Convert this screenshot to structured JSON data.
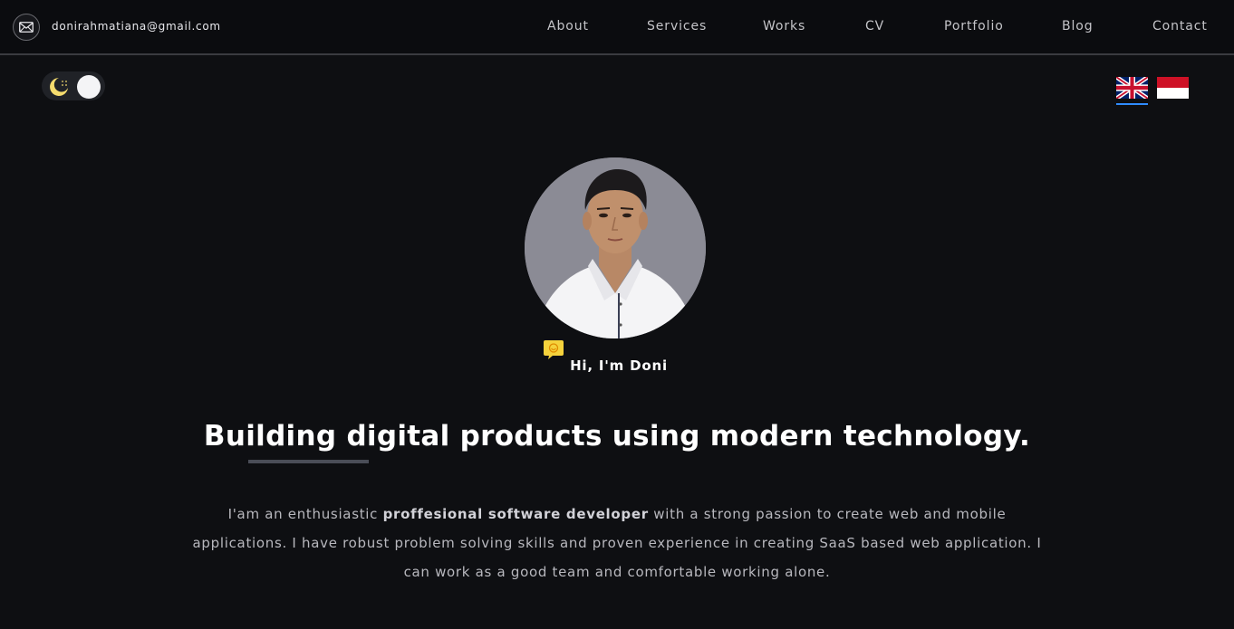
{
  "header": {
    "email": "donirahmatiana@gmail.com",
    "nav": [
      "About",
      "Services",
      "Works",
      "CV",
      "Portfolio",
      "Blog",
      "Contact"
    ]
  },
  "theme_toggle": {
    "mode": "dark"
  },
  "languages": [
    {
      "code": "en",
      "icon": "uk-flag-icon",
      "active": true
    },
    {
      "code": "id",
      "icon": "indonesia-flag-icon",
      "active": false
    }
  ],
  "hero": {
    "greeting": "Hi, I'm Doni",
    "headline": "Building digital products using modern technology.",
    "intro_prefix": "I'am an enthusiastic ",
    "intro_bold": "proffesional software developer",
    "intro_suffix": " with a strong passion to create web and mobile applications. I have robust problem solving skills and proven experience in creating SaaS based web application. I can work as a good team and comfortable working alone."
  },
  "colors": {
    "background": "#0e0f12",
    "accent": "#2f8cff",
    "chat_icon": "#f5d23c"
  }
}
